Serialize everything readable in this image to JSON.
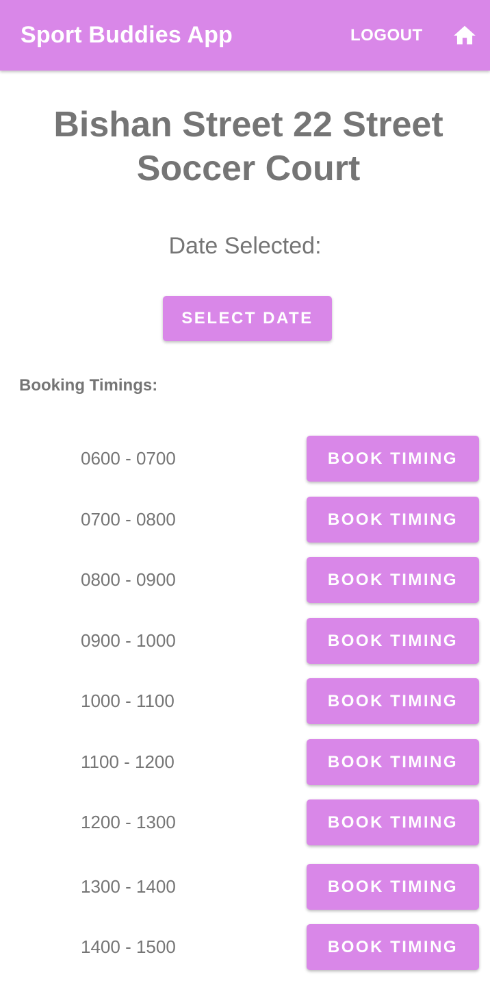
{
  "appbar": {
    "title": "Sport Buddies App",
    "logout_label": "LOGOUT",
    "home_icon": "home-icon",
    "color": "#d987e8"
  },
  "court": {
    "title": "Bishan Street 22 Street Soccer Court"
  },
  "date": {
    "label": "Date Selected:",
    "button_label": "SELECT DATE"
  },
  "booking": {
    "label": "Booking Timings:",
    "button_label": "BOOK TIMING",
    "slots": [
      {
        "time": "0600 - 0700"
      },
      {
        "time": "0700 - 0800"
      },
      {
        "time": "0800 - 0900"
      },
      {
        "time": "0900 - 1000"
      },
      {
        "time": "1000 - 1100"
      },
      {
        "time": "1100 - 1200"
      },
      {
        "time": "1200 - 1300"
      },
      {
        "time": "1300 - 1400"
      },
      {
        "time": "1400 - 1500"
      }
    ]
  }
}
